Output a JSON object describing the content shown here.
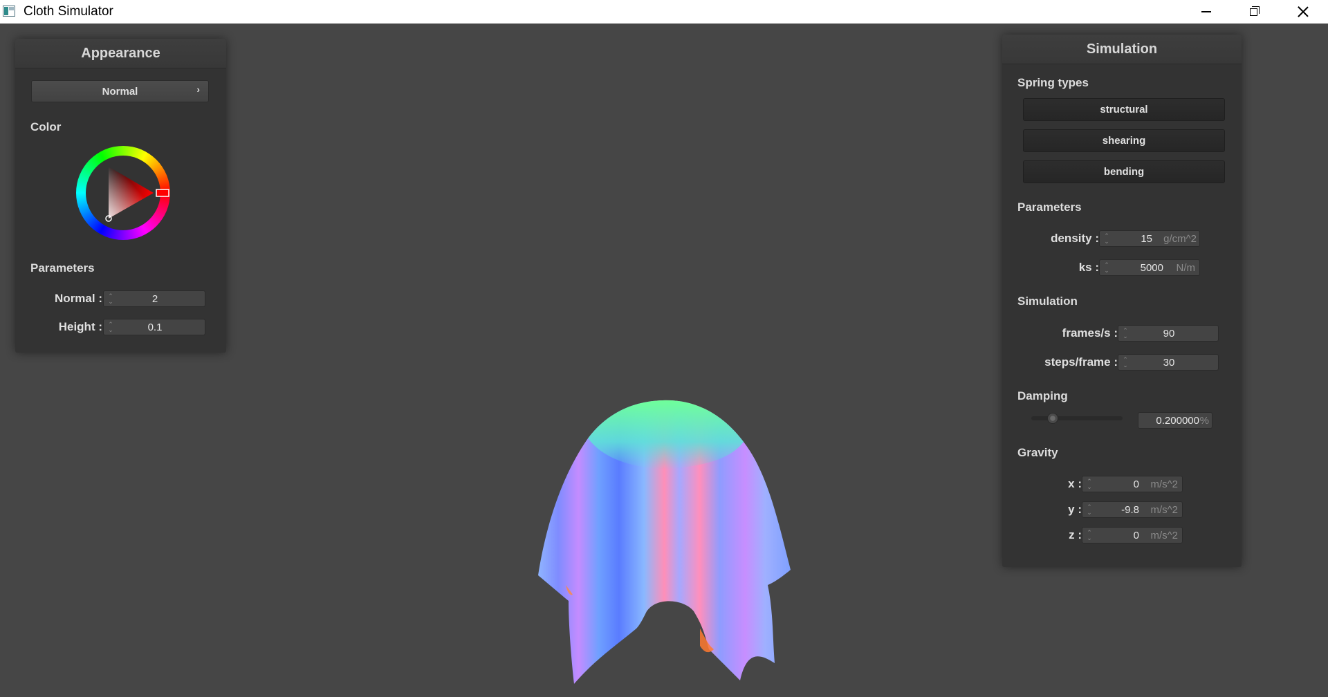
{
  "window": {
    "title": "Cloth Simulator",
    "controls": [
      "minimize-icon",
      "maximize-icon",
      "close-icon"
    ]
  },
  "appearance": {
    "title": "Appearance",
    "shader_select": "Normal",
    "color_label": "Color",
    "selected_color": "#ff0000",
    "parameters_label": "Parameters",
    "normal_label": "Normal :",
    "normal_value": "2",
    "height_label": "Height :",
    "height_value": "0.1"
  },
  "simulation": {
    "title": "Simulation",
    "spring_types_label": "Spring types",
    "spring_types": [
      "structural",
      "shearing",
      "bending"
    ],
    "parameters_label": "Parameters",
    "density_label": "density :",
    "density_value": "15",
    "density_unit": "g/cm^2",
    "ks_label": "ks :",
    "ks_value": "5000",
    "ks_unit": "N/m",
    "simulation_label": "Simulation",
    "fps_label": "frames/s :",
    "fps_value": "90",
    "steps_label": "steps/frame :",
    "steps_value": "30",
    "damping_label": "Damping",
    "damping_value": "0.200000",
    "damping_unit": "%",
    "damping_slider_fraction": 0.2,
    "gravity_label": "Gravity",
    "gx_label": "x :",
    "gx_value": "0",
    "gy_label": "y :",
    "gy_value": "-9.8",
    "gz_label": "z :",
    "gz_value": "0",
    "gravity_unit": "m/s^2"
  },
  "colors": {
    "background": "#464646",
    "panel": "#333333"
  }
}
